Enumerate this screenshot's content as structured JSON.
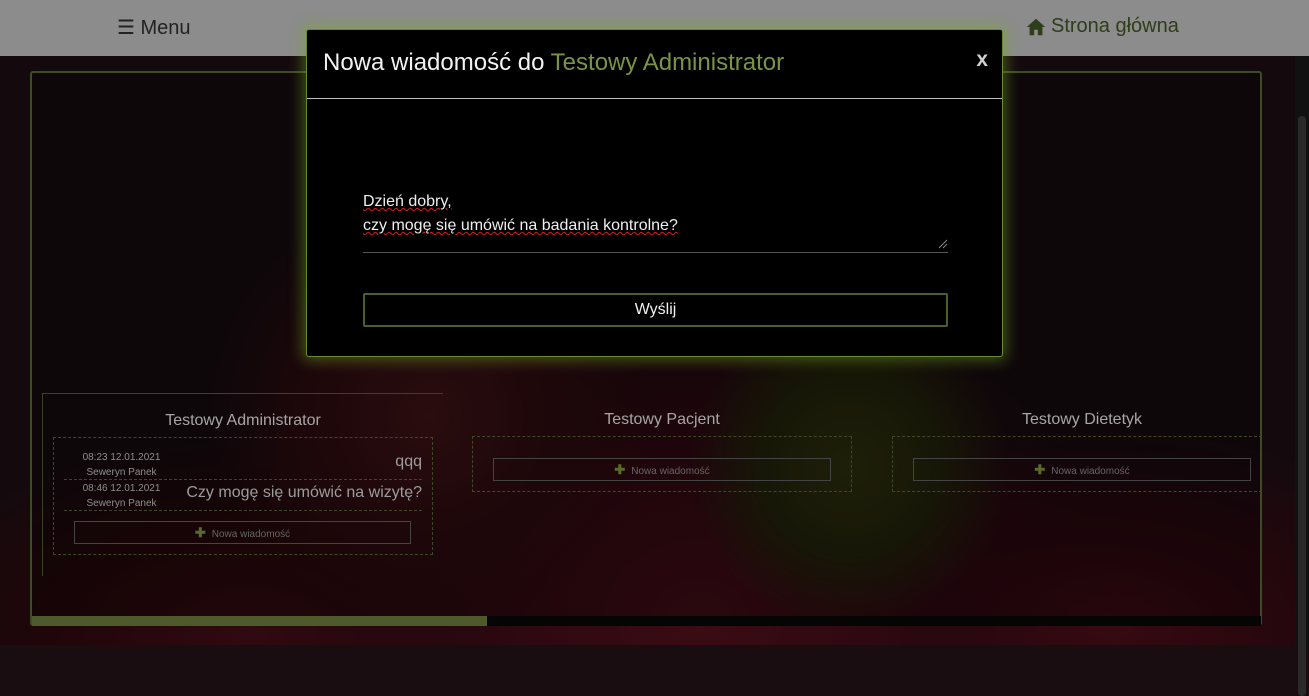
{
  "topbar": {
    "menu_label": "☰ Menu",
    "home_label": "Strona główna",
    "home_icon": "home-icon"
  },
  "progress": {
    "fraction": 0.37
  },
  "conversations": [
    {
      "name": "Testowy Administrator",
      "messages": [
        {
          "time": "08:23 12.01.2021",
          "author": "Seweryn Panek",
          "text": "qqq"
        },
        {
          "time": "08:46 12.01.2021",
          "author": "Seweryn Panek",
          "text": "Czy mogę się umówić na wizytę?"
        }
      ],
      "new_message_label": "Nowa wiadomość"
    },
    {
      "name": "Testowy Pacjent",
      "messages": [],
      "new_message_label": "Nowa wiadomość"
    },
    {
      "name": "Testowy Dietetyk",
      "messages": [],
      "new_message_label": "Nowa wiadomość"
    }
  ],
  "modal": {
    "title_prefix": "Nowa wiadomość do",
    "recipient": "Testowy Administrator",
    "close_label": "x",
    "message_value": "Dzień dobry,\nczy mogę się umówić na badania kontrolne?",
    "send_label": "Wyślij"
  },
  "colors": {
    "accent": "#7a9344",
    "border": "#4d5e28",
    "glow": "#78aa28"
  }
}
